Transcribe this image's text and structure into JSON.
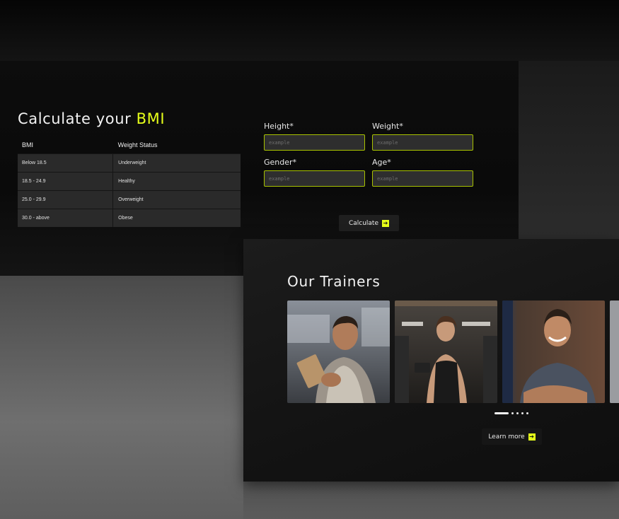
{
  "bmi": {
    "title_prefix": "Calculate your ",
    "title_accent": "BMI",
    "accent_color": "#e6ff1a",
    "table": {
      "headers": [
        "BMI",
        "Weight Status"
      ],
      "rows": [
        [
          "Below 18.5",
          "Underweight"
        ],
        [
          "18.5 - 24.9",
          "Healthy"
        ],
        [
          "25.0 - 29.9",
          "Overweight"
        ],
        [
          "30.0 - above",
          "Obese"
        ]
      ]
    },
    "fields": {
      "height": {
        "label": "Height*",
        "placeholder": "example"
      },
      "weight": {
        "label": "Weight*",
        "placeholder": "example"
      },
      "gender": {
        "label": "Gender*",
        "placeholder": "example"
      },
      "age": {
        "label": "Age*",
        "placeholder": "example"
      }
    },
    "calculate_label": "Calculate"
  },
  "trainers": {
    "title": "Our Trainers",
    "cards": [
      {
        "name": "trainer-photo-1"
      },
      {
        "name": "trainer-photo-2"
      },
      {
        "name": "trainer-photo-3"
      },
      {
        "name": "trainer-photo-4"
      }
    ],
    "carousel": {
      "total": 5,
      "active": 1
    },
    "learn_more_label": "Learn more"
  },
  "icons": {
    "arrow": "arrow-right-icon"
  }
}
